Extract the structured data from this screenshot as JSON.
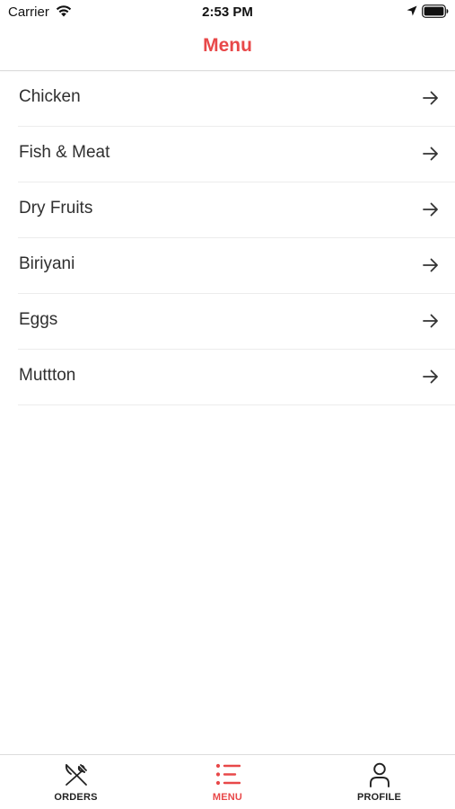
{
  "status_bar": {
    "carrier": "Carrier",
    "time": "2:53 PM",
    "icons": [
      "wifi-icon",
      "location-arrow-icon",
      "battery-icon"
    ]
  },
  "nav": {
    "title": "Menu"
  },
  "menu_items": [
    {
      "label": "Chicken"
    },
    {
      "label": "Fish & Meat"
    },
    {
      "label": "Dry Fruits"
    },
    {
      "label": "Biriyani"
    },
    {
      "label": "Eggs"
    },
    {
      "label": "Muttton"
    }
  ],
  "tab_bar": {
    "tabs": [
      {
        "label": "ORDERS",
        "icon": "fork-knife-icon",
        "active": false
      },
      {
        "label": "MENU",
        "icon": "list-icon",
        "active": true
      },
      {
        "label": "PROFILE",
        "icon": "person-icon",
        "active": false
      }
    ]
  },
  "colors": {
    "accent": "#e84849",
    "text": "#2f2f2f",
    "divider": "#ececec"
  }
}
